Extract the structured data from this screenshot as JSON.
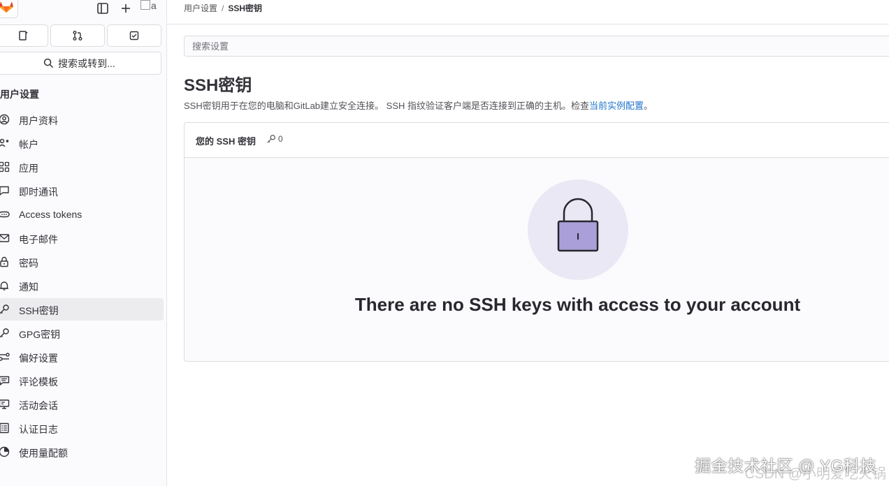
{
  "sidebar": {
    "quick_search_label": "搜索或转到...",
    "section_title": "用户设置",
    "avatar_alt": "a",
    "items": [
      {
        "label": "用户资料",
        "icon": "profile-icon"
      },
      {
        "label": "帐户",
        "icon": "account-icon"
      },
      {
        "label": "应用",
        "icon": "applications-icon"
      },
      {
        "label": "即时通讯",
        "icon": "chat-icon"
      },
      {
        "label": "Access tokens",
        "icon": "token-icon"
      },
      {
        "label": "电子邮件",
        "icon": "mail-icon"
      },
      {
        "label": "密码",
        "icon": "lock-icon"
      },
      {
        "label": "通知",
        "icon": "bell-icon"
      },
      {
        "label": "SSH密钥",
        "icon": "key-icon",
        "active": true
      },
      {
        "label": "GPG密钥",
        "icon": "key-icon"
      },
      {
        "label": "偏好设置",
        "icon": "preferences-icon"
      },
      {
        "label": "评论模板",
        "icon": "comment-icon"
      },
      {
        "label": "活动会话",
        "icon": "monitor-icon"
      },
      {
        "label": "认证日志",
        "icon": "log-icon"
      },
      {
        "label": "使用量配额",
        "icon": "quota-icon"
      }
    ]
  },
  "breadcrumb": {
    "parent": "用户设置",
    "separator": "/",
    "current": "SSH密钥"
  },
  "settings_search": {
    "placeholder": "搜索设置"
  },
  "page": {
    "title": "SSH密钥",
    "description": "SSH密钥用于在您的电脑和GitLab建立安全连接。 SSH 指纹验证客户端是否连接到正确的主机。检查",
    "description_link": "当前实例配置",
    "description_end": "。"
  },
  "keys_card": {
    "title": "您的 SSH 密钥",
    "count": "0",
    "empty_title": "There are no SSH keys with access to your account"
  },
  "watermark": {
    "text": "掘金技术社区 @ YG科技",
    "text2": "CSDN @小明爱吃火锅"
  },
  "colors": {
    "accent": "#1f75cb",
    "active_bg": "#ececef",
    "illustration_bg": "#ebe8f5",
    "lock_fill": "#aa9fd8"
  }
}
